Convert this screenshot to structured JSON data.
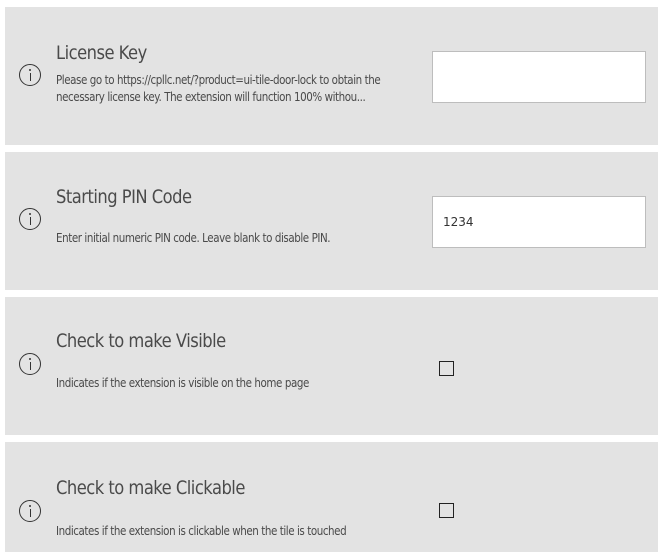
{
  "settings": [
    {
      "id": "license",
      "title": "License Key",
      "description": "Please go to https://cpllc.net/?product=ui-tile-door-lock to obtain the necessary license key. The extension will function 100% withou...",
      "control": "text",
      "value": "",
      "icon": "info-icon"
    },
    {
      "id": "pin",
      "title": "Starting PIN Code",
      "description": "Enter initial numeric PIN code.  Leave blank to disable PIN.",
      "control": "text",
      "value": "1234",
      "icon": "info-icon"
    },
    {
      "id": "visible",
      "title": "Check to make Visible",
      "description": "Indicates if the extension is visible on the home page",
      "control": "checkbox",
      "checked": false,
      "icon": "info-icon"
    },
    {
      "id": "clickable",
      "title": "Check to make Clickable",
      "description": "Indicates if the extension is clickable when the tile is touched",
      "control": "checkbox",
      "checked": false,
      "icon": "info-icon"
    }
  ],
  "colors": {
    "row_background": "#e3e3e3",
    "text": "#4a4a4a",
    "input_border": "#bdbdbd"
  }
}
